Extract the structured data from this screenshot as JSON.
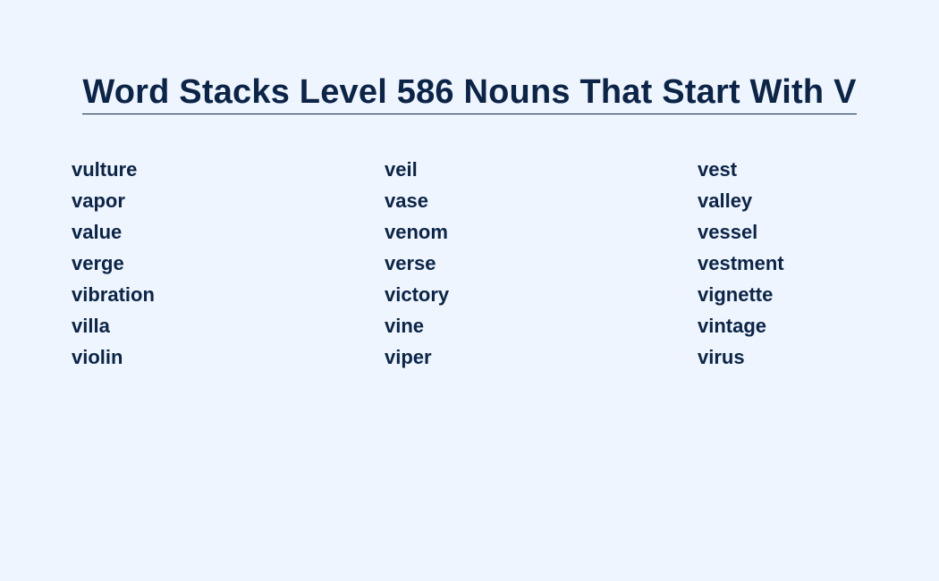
{
  "page": {
    "title": "Word Stacks Level 586 Nouns That Start With V"
  },
  "columns": [
    {
      "words": [
        "vulture",
        "vapor",
        "value",
        "verge",
        "vibration",
        "villa",
        "violin"
      ]
    },
    {
      "words": [
        "veil",
        "vase",
        "venom",
        "verse",
        "victory",
        "vine",
        "viper"
      ]
    },
    {
      "words": [
        "vest",
        "valley",
        "vessel",
        "vestment",
        "vignette",
        "vintage",
        "virus"
      ]
    }
  ],
  "colors": {
    "background": "#eef5fe",
    "text": "#0b2447"
  }
}
